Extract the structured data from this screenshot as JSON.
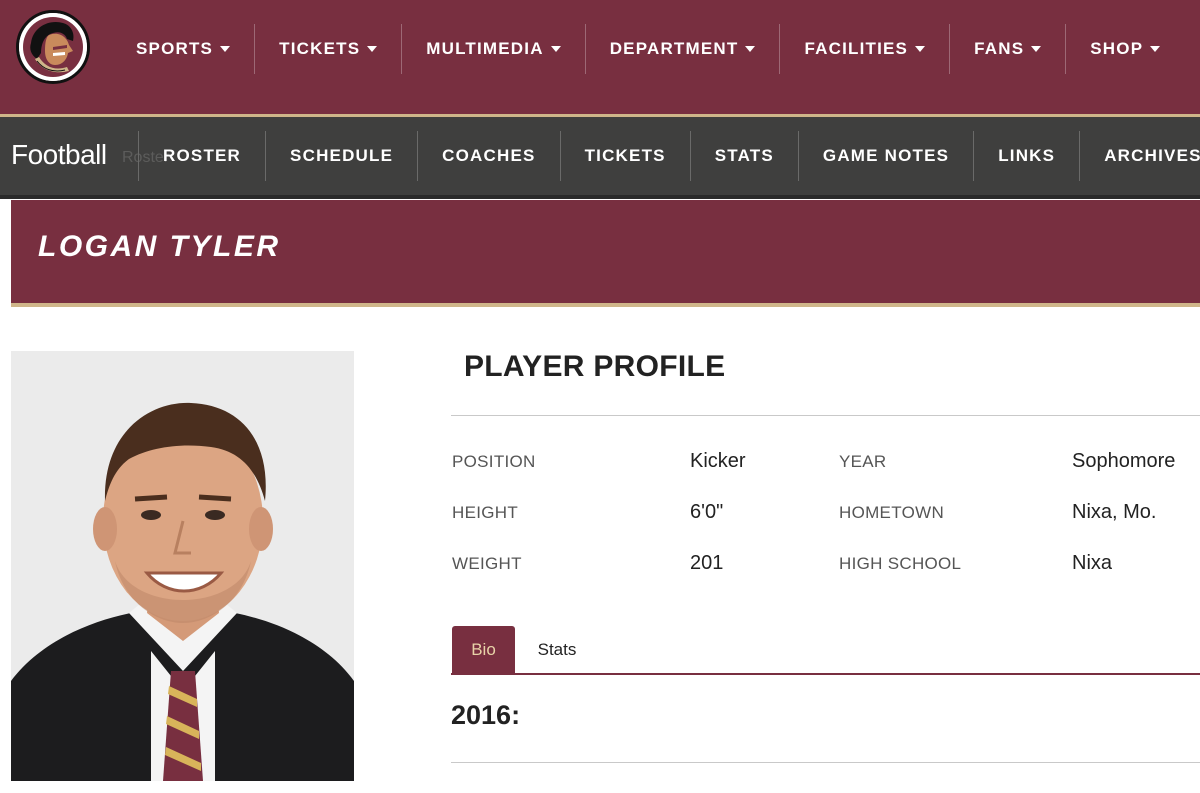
{
  "top_nav": {
    "items": [
      {
        "label": "SPORTS"
      },
      {
        "label": "TICKETS"
      },
      {
        "label": "MULTIMEDIA"
      },
      {
        "label": "DEPARTMENT"
      },
      {
        "label": "FACILITIES"
      },
      {
        "label": "FANS"
      },
      {
        "label": "SHOP"
      }
    ]
  },
  "sport_nav": {
    "title": "Football",
    "ghost_text": "Roster",
    "items": [
      {
        "label": "ROSTER"
      },
      {
        "label": "SCHEDULE"
      },
      {
        "label": "COACHES"
      },
      {
        "label": "TICKETS"
      },
      {
        "label": "STATS"
      },
      {
        "label": "GAME NOTES"
      },
      {
        "label": "LINKS"
      },
      {
        "label": "ARCHIVES"
      }
    ]
  },
  "player": {
    "name": "LOGAN TYLER"
  },
  "profile": {
    "title": "PLAYER PROFILE",
    "fields": [
      {
        "label": "POSITION",
        "value": "Kicker"
      },
      {
        "label": "YEAR",
        "value": "Sophomore"
      },
      {
        "label": "HEIGHT",
        "value": "6'0\""
      },
      {
        "label": "HOMETOWN",
        "value": "Nixa, Mo."
      },
      {
        "label": "WEIGHT",
        "value": "201"
      },
      {
        "label": "HIGH SCHOOL",
        "value": "Nixa"
      }
    ]
  },
  "tabs": [
    {
      "label": "Bio",
      "active": true
    },
    {
      "label": "Stats",
      "active": false
    }
  ],
  "bio": {
    "year_heading": "2016:"
  },
  "colors": {
    "garnet": "#782f40",
    "gold": "#cfb68a",
    "subnav_bg": "#3f3f3e"
  },
  "icons": {
    "logo": "seminole-head-logo",
    "caret": "caret-down-icon"
  }
}
